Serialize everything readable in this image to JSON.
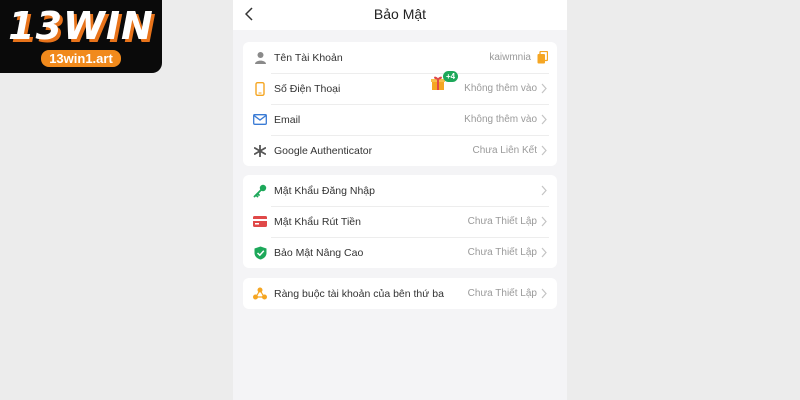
{
  "brand": {
    "logo_text": "13WIN",
    "logo_url": "13win1.art"
  },
  "header": {
    "title": "Bảo Mật"
  },
  "groups": [
    {
      "items": [
        {
          "label": "Tên Tài Khoản",
          "value": "kaiwmnia",
          "icon": "user-icon"
        },
        {
          "label": "Số Điện Thoại",
          "value": "Không thêm vào",
          "icon": "phone-icon",
          "badge": "+4"
        },
        {
          "label": "Email",
          "value": "Không thêm vào",
          "icon": "email-icon"
        },
        {
          "label": "Google Authenticator",
          "value": "Chưa Liên Kết",
          "icon": "authenticator-icon"
        }
      ]
    },
    {
      "items": [
        {
          "label": "Mật Khẩu Đăng Nhập",
          "value": "",
          "icon": "key-icon"
        },
        {
          "label": "Mật Khẩu Rút Tiền",
          "value": "Chưa Thiết Lập",
          "icon": "card-icon"
        },
        {
          "label": "Bảo Mật Nâng Cao",
          "value": "Chưa Thiết Lập",
          "icon": "shield-icon"
        }
      ]
    },
    {
      "items": [
        {
          "label": "Ràng buộc tài khoản của bên thứ ba",
          "value": "Chưa Thiết Lập",
          "icon": "link-nodes-icon"
        }
      ]
    }
  ],
  "colors": {
    "accent_orange": "#f5a623",
    "green": "#1da85a",
    "blue": "#3a7bd5",
    "red": "#e04848"
  }
}
